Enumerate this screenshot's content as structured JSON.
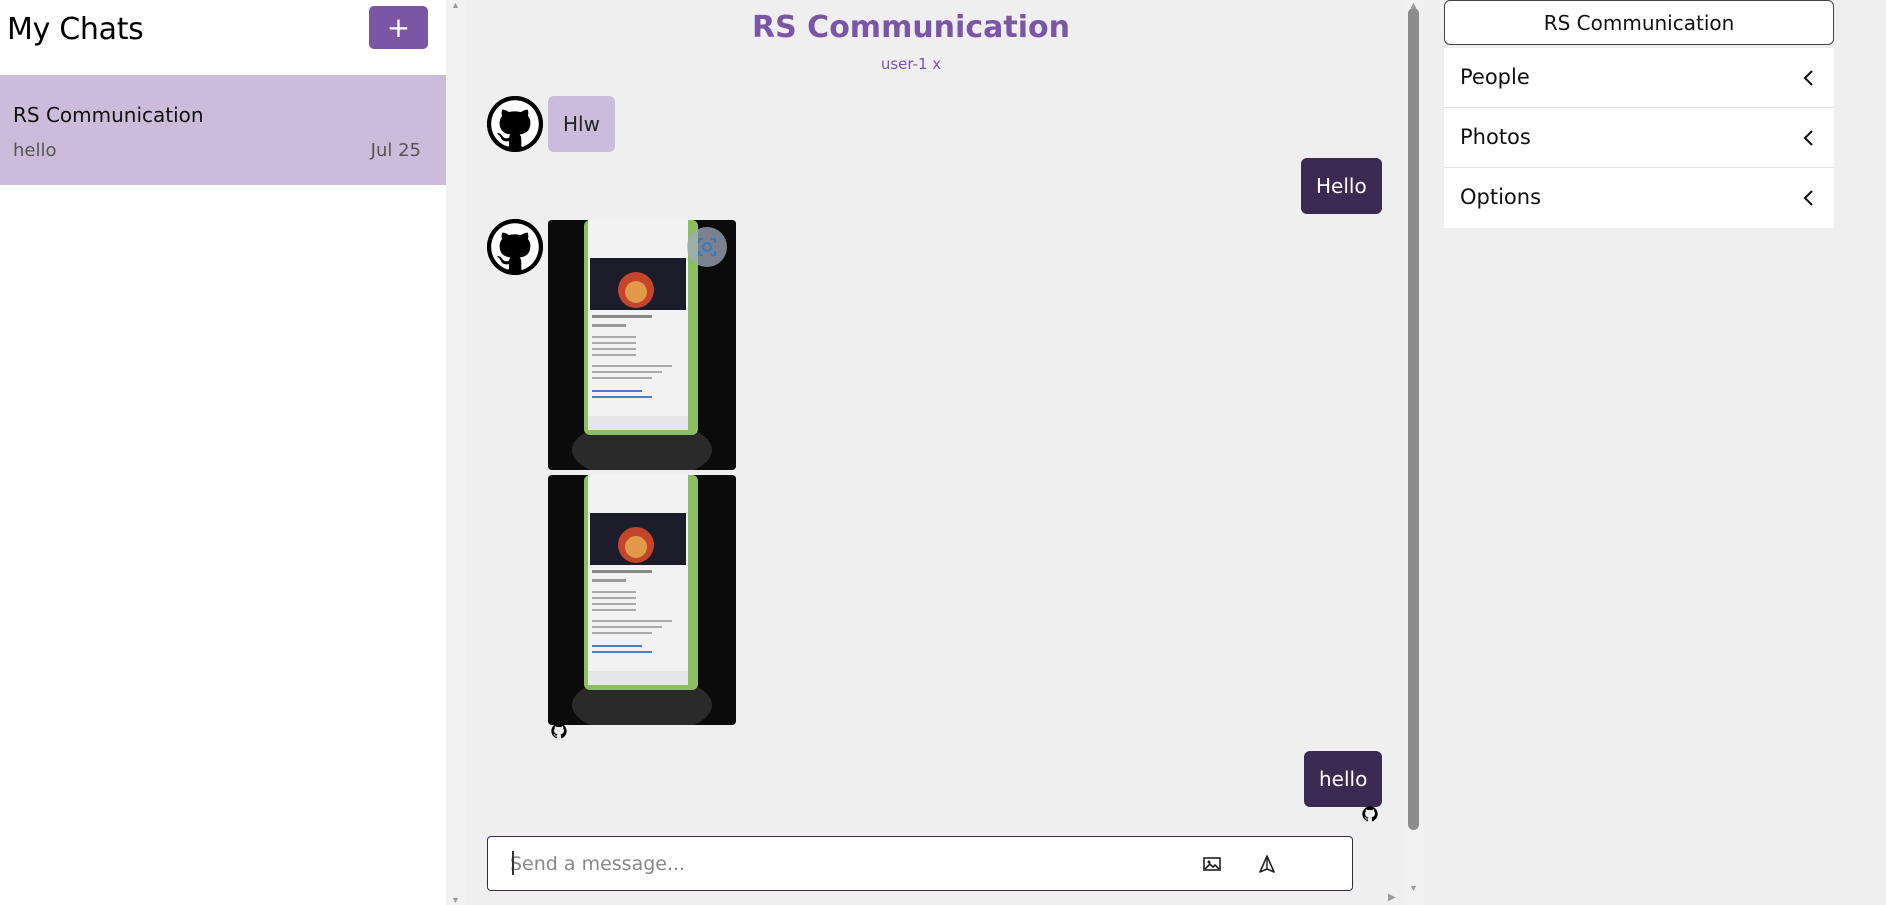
{
  "sidebar": {
    "title": "My Chats",
    "new_chat_label": "+",
    "chats": [
      {
        "name": "RS Communication",
        "preview": "hello",
        "date": "Jul 25"
      }
    ]
  },
  "chat": {
    "title": "RS Communication",
    "subtitle": "user-1 x",
    "messages": [
      {
        "direction": "in",
        "type": "text",
        "text": "Hlw"
      },
      {
        "direction": "out",
        "type": "text",
        "text": "Hello"
      },
      {
        "direction": "in",
        "type": "image"
      },
      {
        "direction": "in",
        "type": "image"
      },
      {
        "direction": "out",
        "type": "text",
        "text": "hello"
      }
    ],
    "composer": {
      "placeholder": "Send a message...",
      "value": ""
    }
  },
  "right_panel": {
    "title": "RS Communication",
    "items": [
      {
        "label": "People"
      },
      {
        "label": "Photos"
      },
      {
        "label": "Options"
      }
    ]
  },
  "colors": {
    "accent": "#7b55a6",
    "incoming_bubble": "#cbbcdc",
    "outgoing_bubble": "#3a2a52",
    "chat_background": "#efefef"
  },
  "icons": {
    "avatar": "github-icon",
    "image_button": "image-icon",
    "send_button": "send-icon",
    "chevron": "chevron-left-icon",
    "scan": "scan-icon"
  }
}
